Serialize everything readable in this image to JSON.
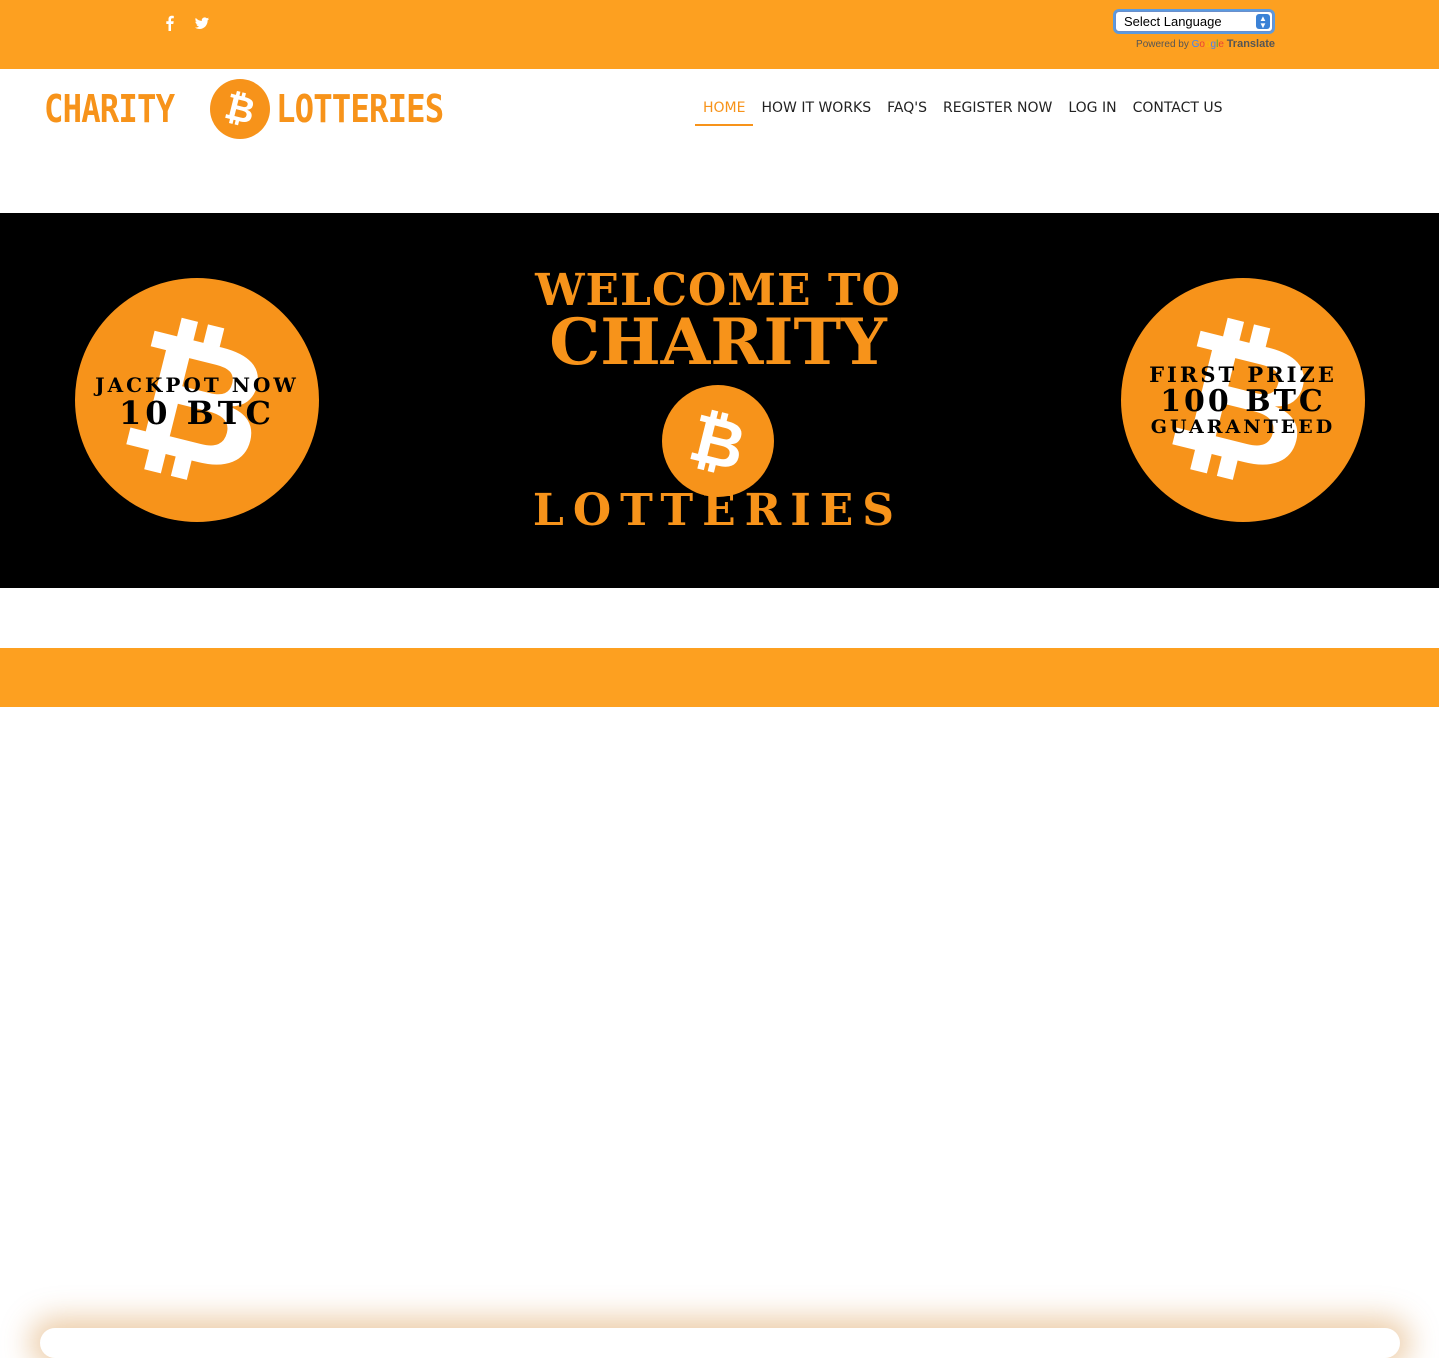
{
  "topbar": {
    "social": [
      {
        "icon": "facebook-icon"
      },
      {
        "icon": "twitter-icon"
      }
    ],
    "language": {
      "selected": "Select Language",
      "powered_by": "Powered by",
      "google": [
        "G",
        "o",
        "o",
        "g",
        "l",
        "e"
      ],
      "translate": "Translate"
    }
  },
  "header": {
    "logo": {
      "left": "CHARITY",
      "right": "LOTTERIES"
    },
    "nav": [
      {
        "label": "HOME",
        "active": true
      },
      {
        "label": "HOW IT WORKS",
        "active": false
      },
      {
        "label": "FAQ'S",
        "active": false
      },
      {
        "label": "REGISTER NOW",
        "active": false
      },
      {
        "label": "LOG IN",
        "active": false
      },
      {
        "label": "CONTACT US",
        "active": false
      }
    ]
  },
  "hero": {
    "welcome": "WELCOME TO",
    "charity": "CHARITY",
    "lotteries": "LOTTERIES",
    "left_badge": {
      "line1": "JACKPOT NOW",
      "line2": "10 BTC"
    },
    "right_badge": {
      "line1": "FIRST PRIZE",
      "line2": "100 BTC",
      "line3": "GUARANTEED"
    }
  },
  "colors": {
    "orange": "#f7931a",
    "bar": "#fda020"
  }
}
